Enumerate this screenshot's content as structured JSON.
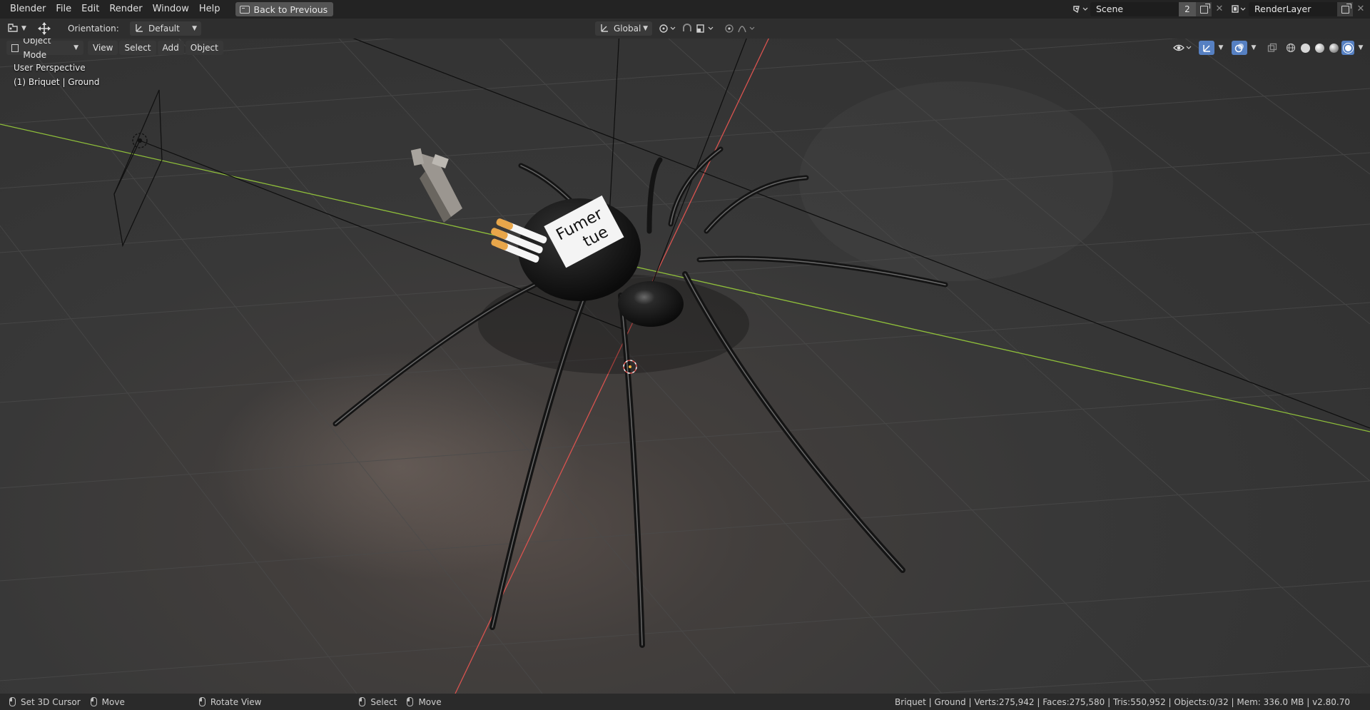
{
  "topbar": {
    "menus": [
      "Blender",
      "File",
      "Edit",
      "Render",
      "Window",
      "Help"
    ],
    "back_button": "Back to Previous",
    "scene": {
      "name": "Scene",
      "count": "2"
    },
    "render_layer": {
      "name": "RenderLayer"
    }
  },
  "toolbar": {
    "orientation_label": "Orientation:",
    "orientation_value": "Default",
    "transform_orientation": "Global"
  },
  "viewport_header": {
    "mode": "Object Mode",
    "menus": [
      "View",
      "Select",
      "Add",
      "Object"
    ]
  },
  "viewport": {
    "perspective": "User Perspective",
    "active_object": "(1) Briquet | Ground",
    "label_text_1": "Fumer",
    "label_text_2": "tue"
  },
  "statusbar": {
    "hints": [
      "Set 3D Cursor",
      "Move",
      "Rotate View",
      "Select",
      "Move"
    ],
    "stats": "Briquet | Ground | Verts:275,942 | Faces:275,580 | Tris:550,952 | Objects:0/32 | Mem: 336.0 MB | v2.80.70"
  },
  "colors": {
    "accent": "#5680c2",
    "x_axis": "#d9534f",
    "y_axis": "#8fbf3a",
    "button": "#545454",
    "bar": "#232323"
  },
  "icons": [
    "editor-type-icon",
    "transform-gizmo-icon",
    "orientation-icon",
    "global-axis-icon",
    "pivot-icon",
    "snap-icon",
    "proportional-icon",
    "visibility-icon",
    "gizmo-icon",
    "overlay-icon",
    "xray-icon",
    "wireframe-icon",
    "solid-icon",
    "material-icon",
    "rendered-icon",
    "scene-icon",
    "renderlayer-icon",
    "mouse-icon"
  ]
}
